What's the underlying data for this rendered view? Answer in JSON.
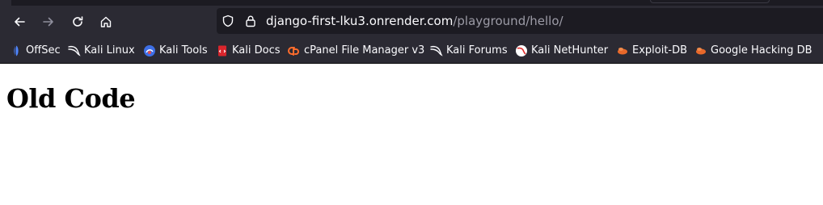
{
  "browser": {
    "url": {
      "domain": "django-first-lku3.onrender.com",
      "path": "/playground/hello/"
    },
    "nav_icons": [
      "back-arrow-icon",
      "forward-arrow-icon",
      "reload-icon",
      "home-icon"
    ],
    "urlbar_icons": [
      "tracking-shield-icon",
      "lock-icon"
    ],
    "bookmarks": [
      {
        "label": "OffSec",
        "icon": "offsec-icon"
      },
      {
        "label": "Kali Linux",
        "icon": "kali-dragon-icon"
      },
      {
        "label": "Kali Tools",
        "icon": "kali-tools-icon"
      },
      {
        "label": "Kali Docs",
        "icon": "kali-docs-icon"
      },
      {
        "label": "cPanel File Manager v3",
        "icon": "cpanel-icon"
      },
      {
        "label": "Kali Forums",
        "icon": "kali-dragon-icon"
      },
      {
        "label": "Kali NetHunter",
        "icon": "nethunter-icon"
      },
      {
        "label": "Exploit-DB",
        "icon": "exploit-db-icon"
      },
      {
        "label": "Google Hacking DB",
        "icon": "exploit-db-icon"
      }
    ]
  },
  "page": {
    "heading": "Old Code"
  },
  "colors": {
    "toolbar": "#2b2a33",
    "urlbar": "#1c1b22",
    "text": "#fbfbfe",
    "url_path": "#9c9ba6",
    "page_bg": "#ffffff"
  }
}
